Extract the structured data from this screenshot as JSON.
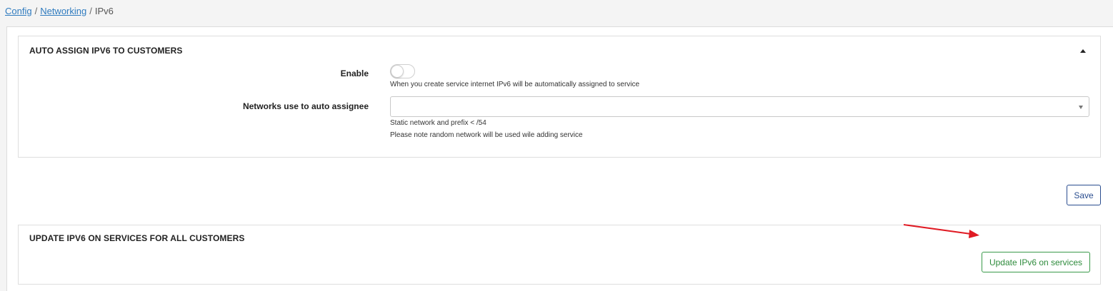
{
  "breadcrumb": {
    "config": "Config",
    "networking": "Networking",
    "current": "IPv6",
    "separator": "/"
  },
  "auto_assign_panel": {
    "title": "AUTO ASSIGN IPV6 TO CUSTOMERS",
    "enable_label": "Enable",
    "enable_value": false,
    "enable_hint": "When you create service internet IPv6 will be automatically assigned to service",
    "networks_label": "Networks use to auto assignee",
    "networks_value": "",
    "networks_hint_static": "Static network and prefix < /54",
    "networks_hint_random": "Please note random network will be used wile adding service",
    "collapse_icon": "triangle-up-icon"
  },
  "save_button": "Save",
  "update_panel": {
    "title": "UPDATE IPV6 ON SERVICES FOR ALL CUSTOMERS",
    "button_label": "Update IPv6 on services"
  },
  "colors": {
    "link": "#2f7bbf",
    "save_border": "#2a4d8f",
    "update_border": "#3a9a4a",
    "annotation_arrow": "#e01b24"
  }
}
